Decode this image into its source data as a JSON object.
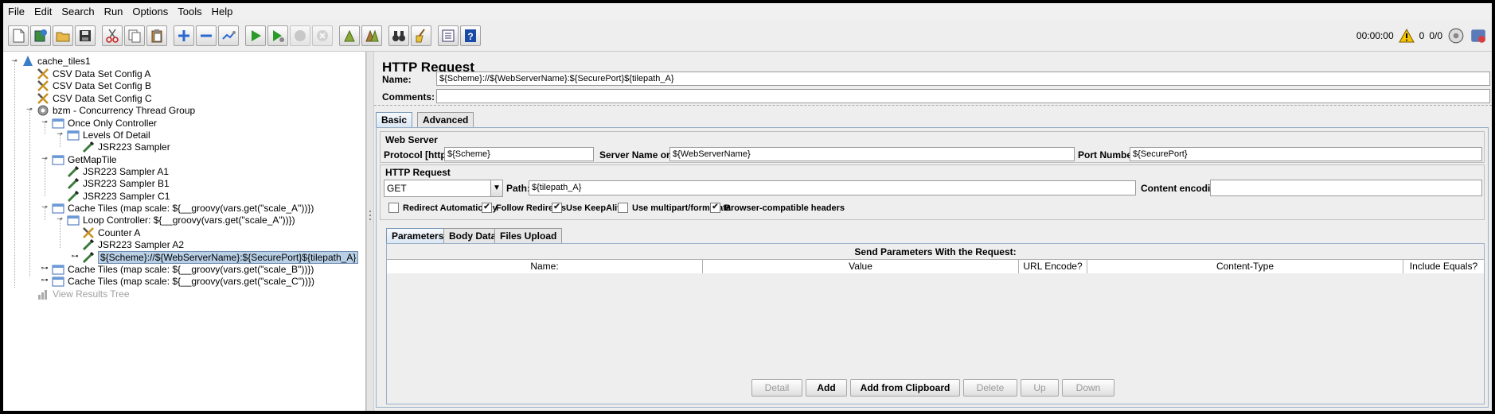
{
  "menu": [
    "File",
    "Edit",
    "Search",
    "Run",
    "Options",
    "Tools",
    "Help"
  ],
  "toolbar": {
    "buttons": [
      "new-icon",
      "templates-icon",
      "open-icon",
      "save-icon",
      "cut-icon",
      "copy-icon",
      "paste-icon",
      "expand-icon",
      "collapse-icon",
      "toggle-icon",
      "start-icon",
      "start-no-pauses-icon",
      "stop-icon",
      "shutdown-icon",
      "clear-icon",
      "clear-all-icon",
      "search-icon",
      "reset-search-icon",
      "function-helper-icon",
      "help-icon"
    ],
    "timer": "00:00:00",
    "warning_count": "0",
    "threads": "0/0"
  },
  "tree": [
    {
      "label": "cache_tiles1",
      "icon": "test-plan-icon"
    },
    {
      "label": "CSV Data Set Config A",
      "icon": "config-icon"
    },
    {
      "label": "CSV Data Set Config B",
      "icon": "config-icon"
    },
    {
      "label": "CSV Data Set Config C",
      "icon": "config-icon"
    },
    {
      "label": "bzm - Concurrency Thread Group",
      "icon": "thread-group-icon"
    },
    {
      "label": "Once Only Controller",
      "icon": "controller-icon"
    },
    {
      "label": "Levels Of Detail",
      "icon": "controller-icon"
    },
    {
      "label": "JSR223 Sampler",
      "icon": "sampler-icon"
    },
    {
      "label": "GetMapTile",
      "icon": "controller-icon"
    },
    {
      "label": "JSR223 Sampler A1",
      "icon": "sampler-icon"
    },
    {
      "label": "JSR223 Sampler B1",
      "icon": "sampler-icon"
    },
    {
      "label": "JSR223 Sampler C1",
      "icon": "sampler-icon"
    },
    {
      "label": "Cache Tiles (map scale: ${__groovy(vars.get(\"scale_A\"))})",
      "icon": "controller-icon"
    },
    {
      "label": "Loop Controller: ${__groovy(vars.get(\"scale_A\"))})",
      "icon": "controller-icon"
    },
    {
      "label": "Counter A",
      "icon": "config-icon"
    },
    {
      "label": "JSR223 Sampler A2",
      "icon": "sampler-icon"
    },
    {
      "label": "${Scheme}://${WebServerName}:${SecurePort}${tilepath_A}",
      "icon": "sampler-icon"
    },
    {
      "label": "Cache Tiles (map scale: ${__groovy(vars.get(\"scale_B\"))})",
      "icon": "controller-icon"
    },
    {
      "label": "Cache Tiles (map scale: ${__groovy(vars.get(\"scale_C\"))})",
      "icon": "controller-icon"
    },
    {
      "label": "View Results Tree",
      "icon": "listener-icon"
    }
  ],
  "panel": {
    "title": "HTTP Request",
    "name_label": "Name:",
    "name_value": "${Scheme}://${WebServerName}:${SecurePort}${tilepath_A}",
    "comments_label": "Comments:",
    "comments_value": "",
    "tabs": [
      "Basic",
      "Advanced"
    ],
    "web_server": {
      "title": "Web Server",
      "protocol_label": "Protocol [http]:",
      "protocol_value": "${Scheme}",
      "server_label": "Server Name or IP:",
      "server_value": "${WebServerName}",
      "port_label": "Port Number:",
      "port_value": "${SecurePort}"
    },
    "http_request": {
      "title": "HTTP Request",
      "method": "GET",
      "path_label": "Path:",
      "path_value": "${tilepath_A}",
      "encoding_label": "Content encoding:",
      "encoding_value": ""
    },
    "checkboxes": [
      {
        "label": "Redirect Automatically",
        "checked": false,
        "mark": ""
      },
      {
        "label": "Follow Redirects",
        "checked": true,
        "mark": "✔"
      },
      {
        "label": "Use KeepAlive",
        "checked": true,
        "mark": "✔"
      },
      {
        "label": "Use multipart/form-data",
        "checked": false,
        "mark": ""
      },
      {
        "label": "Browser-compatible headers",
        "checked": true,
        "mark": "✔"
      }
    ],
    "subtabs": [
      "Parameters",
      "Body Data",
      "Files Upload"
    ],
    "params": {
      "title": "Send Parameters With the Request:",
      "columns": [
        "Name:",
        "Value",
        "URL Encode?",
        "Content-Type",
        "Include Equals?"
      ]
    },
    "buttons": [
      "Detail",
      "Add",
      "Add from Clipboard",
      "Delete",
      "Up",
      "Down"
    ]
  },
  "colors": {
    "accent": "#7a9ab8",
    "selection": "#b8cfe5",
    "background": "#eeeeee"
  }
}
